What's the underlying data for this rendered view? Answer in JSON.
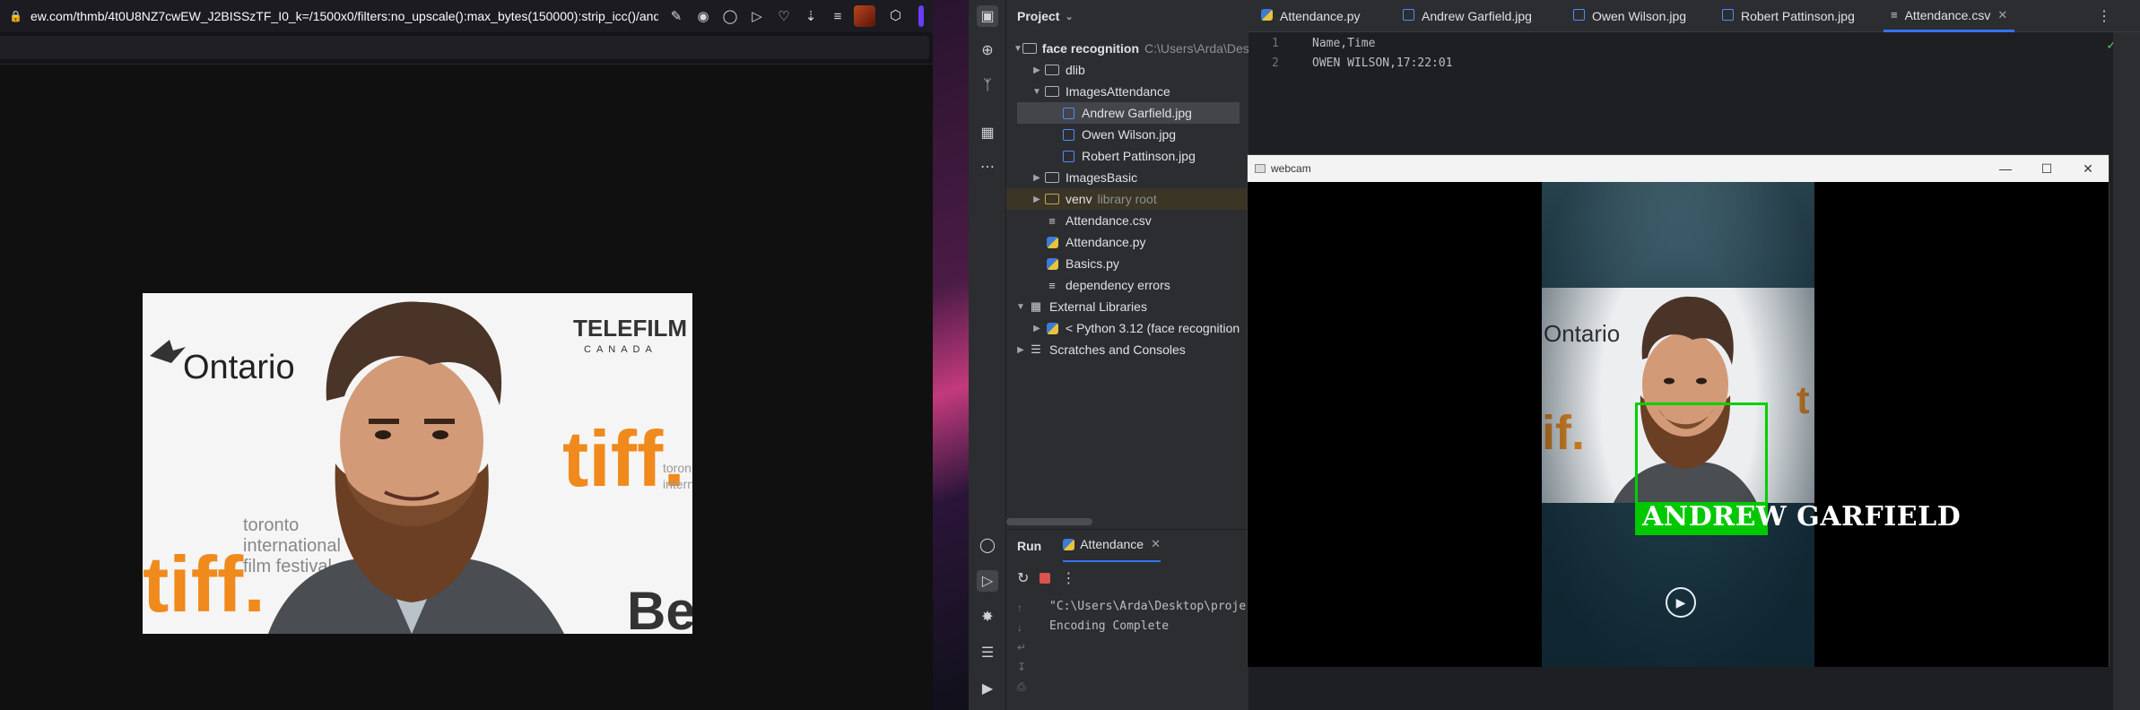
{
  "browser": {
    "url": "ew.com/thmb/4t0U8NZ7cwEW_J2BISSzTF_I0_k=/1500x0/filters:no_upscale():max_bytes(150000):strip_icc()/andrew-garfiel",
    "icons": [
      "lock-icon",
      "edit-icon",
      "camera-icon",
      "shield-icon",
      "send-icon",
      "heart-icon",
      "download-icon",
      "menu-icon",
      "extension-avatar",
      "cube-icon"
    ]
  },
  "project_panel": {
    "title": "Project",
    "tree": [
      {
        "label": "face recognition",
        "hint": "C:\\Users\\Arda\\Des",
        "type": "folder",
        "expanded": true
      },
      {
        "label": "dlib",
        "type": "folder",
        "expanded": false
      },
      {
        "label": "ImagesAttendance",
        "type": "folder",
        "expanded": true
      },
      {
        "label": "Andrew Garfield.jpg",
        "type": "image",
        "selected": true
      },
      {
        "label": "Owen Wilson.jpg",
        "type": "image"
      },
      {
        "label": "Robert Pattinson.jpg",
        "type": "image"
      },
      {
        "label": "ImagesBasic",
        "type": "folder",
        "expanded": false
      },
      {
        "label": "venv",
        "hint": "library root",
        "type": "folder",
        "expanded": false
      },
      {
        "label": "Attendance.csv",
        "type": "text"
      },
      {
        "label": "Attendance.py",
        "type": "python"
      },
      {
        "label": "Basics.py",
        "type": "python"
      },
      {
        "label": "dependency errors",
        "type": "text"
      },
      {
        "label": "External Libraries",
        "type": "library",
        "expanded": true
      },
      {
        "label": "< Python 3.12 (face recognition",
        "type": "python",
        "expanded": false
      },
      {
        "label": "Scratches and Consoles",
        "type": "scratch",
        "expanded": false
      }
    ]
  },
  "editor": {
    "tabs": [
      {
        "label": "Attendance.py",
        "icon": "python-icon"
      },
      {
        "label": "Andrew Garfield.jpg",
        "icon": "image-icon"
      },
      {
        "label": "Owen Wilson.jpg",
        "icon": "image-icon"
      },
      {
        "label": "Robert Pattinson.jpg",
        "icon": "image-icon"
      },
      {
        "label": "Attendance.csv",
        "icon": "text-icon",
        "active": true
      }
    ],
    "lines": [
      {
        "num": "1",
        "text": "Name,Time"
      },
      {
        "num": "2",
        "text": "OWEN WILSON,17:22:01"
      }
    ]
  },
  "run_panel": {
    "title": "Run",
    "tab": "Attendance",
    "console": [
      "\"C:\\Users\\Arda\\Desktop\\proje",
      "Encoding Complete"
    ]
  },
  "webcam": {
    "title": "webcam",
    "detected_name": "ANDREW GARFIELD",
    "box_color": "#00d000"
  },
  "colors": {
    "accent": "#3574f0",
    "ide_bg": "#1e1f22",
    "panel_bg": "#2b2d30"
  }
}
